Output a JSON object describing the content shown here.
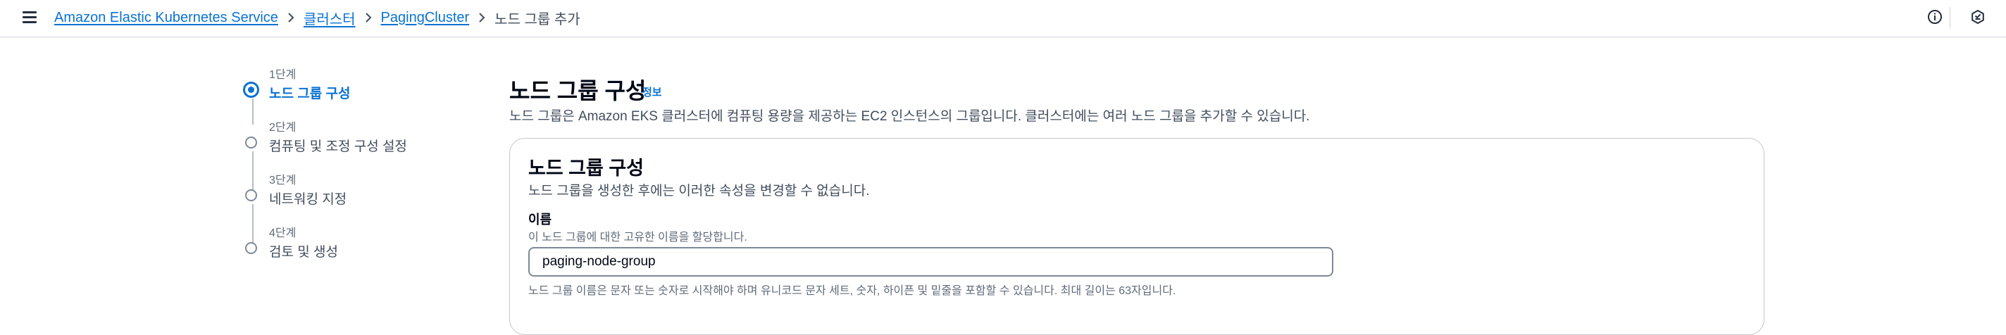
{
  "header": {
    "menu_icon": "hamburger-menu-icon",
    "breadcrumbs": [
      {
        "label": "Amazon Elastic Kubernetes Service",
        "link": true
      },
      {
        "label": "클러스터",
        "link": true
      },
      {
        "label": "PagingCluster",
        "link": true
      },
      {
        "label": "노드 그룹 추가",
        "link": false
      }
    ],
    "right_icons": [
      "info-circle-icon",
      "notifications-icon"
    ]
  },
  "steps": [
    {
      "number": "1단계",
      "title": "노드 그룹 구성",
      "active": true
    },
    {
      "number": "2단계",
      "title": "컴퓨팅 및 조정 구성 설정",
      "active": false
    },
    {
      "number": "3단계",
      "title": "네트워킹 지정",
      "active": false
    },
    {
      "number": "4단계",
      "title": "검토 및 생성",
      "active": false
    }
  ],
  "main": {
    "title": "노드 그룹 구성",
    "info_link": "정보",
    "description": "노드 그룹은 Amazon EKS 클러스터에 컴퓨팅 용량을 제공하는 EC2 인스턴스의 그룹입니다. 클러스터에는 여러 노드 그룹을 추가할 수 있습니다."
  },
  "panel": {
    "title": "노드 그룹 구성",
    "description": "노드 그룹을 생성한 후에는 이러한 속성을 변경할 수 없습니다.",
    "name_field": {
      "label": "이름",
      "description": "이 노드 그룹에 대한 고유한 이름을 할당합니다.",
      "value": "paging-node-group",
      "constraint": "노드 그룹 이름은 문자 또는 숫자로 시작해야 하며 유니코드 문자 세트, 숫자, 하이픈 및 밑줄을 포함할 수 있습니다. 최대 길이는 63자입니다."
    }
  },
  "colors": {
    "link": "#0972d3",
    "text": "#000716",
    "secondary_text": "#414d5c",
    "border": "#7d8998"
  }
}
